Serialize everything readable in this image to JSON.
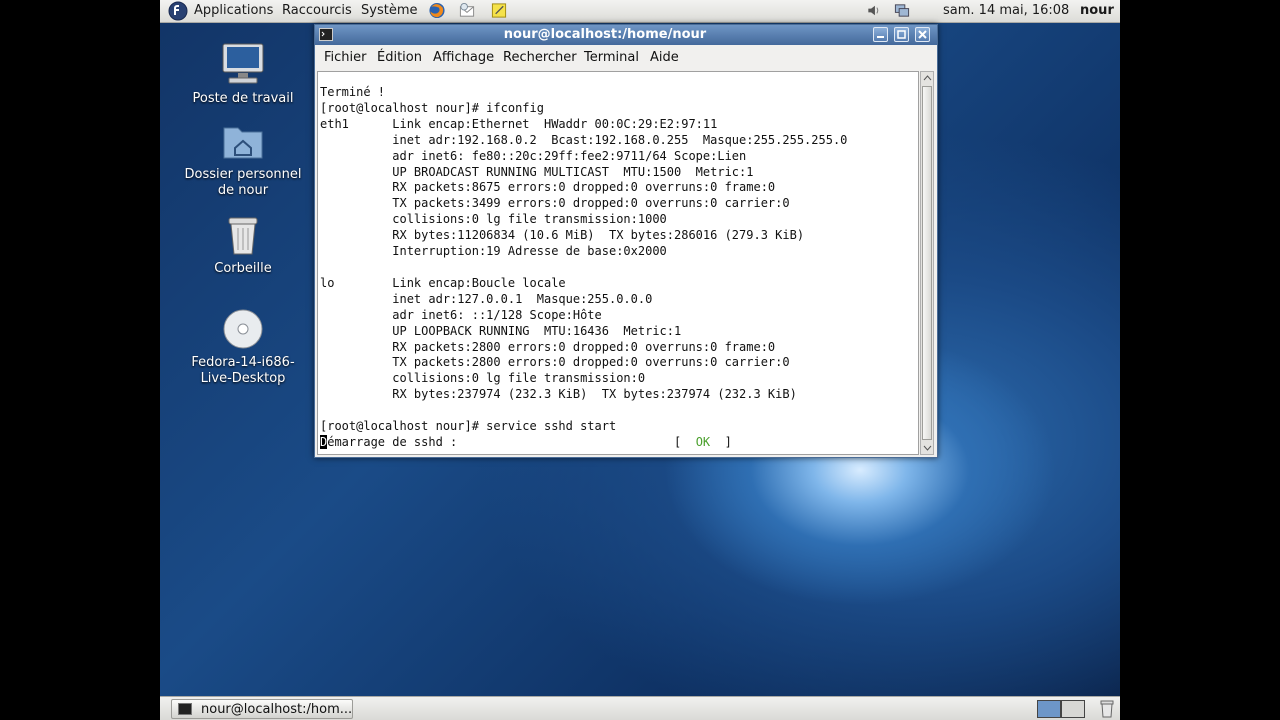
{
  "top_panel": {
    "menus": [
      "Applications",
      "Raccourcis",
      "Système"
    ],
    "clock": "sam. 14 mai, 16:08",
    "user": "nour"
  },
  "desktop_icons": [
    {
      "label": "Poste de travail",
      "icon": "computer-icon"
    },
    {
      "label": "Dossier personnel de nour",
      "icon": "home-folder-icon"
    },
    {
      "label": "Corbeille",
      "icon": "trash-icon"
    },
    {
      "label": "Fedora-14-i686-Live-Desktop",
      "icon": "dvd-icon"
    }
  ],
  "terminal": {
    "title": "nour@localhost:/home/nour",
    "menu": [
      "Fichier",
      "Édition",
      "Affichage",
      "Rechercher",
      "Terminal",
      "Aide"
    ],
    "lines": [
      "Terminé !",
      "[root@localhost nour]# ifconfig",
      "eth1      Link encap:Ethernet  HWaddr 00:0C:29:E2:97:11",
      "          inet adr:192.168.0.2  Bcast:192.168.0.255  Masque:255.255.255.0",
      "          adr inet6: fe80::20c:29ff:fee2:9711/64 Scope:Lien",
      "          UP BROADCAST RUNNING MULTICAST  MTU:1500  Metric:1",
      "          RX packets:8675 errors:0 dropped:0 overruns:0 frame:0",
      "          TX packets:3499 errors:0 dropped:0 overruns:0 carrier:0",
      "          collisions:0 lg file transmission:1000",
      "          RX bytes:11206834 (10.6 MiB)  TX bytes:286016 (279.3 KiB)",
      "          Interruption:19 Adresse de base:0x2000",
      "",
      "lo        Link encap:Boucle locale",
      "          inet adr:127.0.0.1  Masque:255.0.0.0",
      "          adr inet6: ::1/128 Scope:Hôte",
      "          UP LOOPBACK RUNNING  MTU:16436  Metric:1",
      "          RX packets:2800 errors:0 dropped:0 overruns:0 frame:0",
      "          TX packets:2800 errors:0 dropped:0 overruns:0 carrier:0",
      "          collisions:0 lg file transmission:0",
      "          RX bytes:237974 (232.3 KiB)  TX bytes:237974 (232.3 KiB)",
      "",
      "[root@localhost nour]# service sshd start"
    ],
    "last_line": {
      "cursor_char": "D",
      "text": "émarrage de sshd :                              [  ",
      "status": "OK",
      "tail": "  ]"
    },
    "colors": {
      "ok": "#4aa02c",
      "title_bar": "#5a80b3"
    }
  },
  "taskbar": {
    "window_button": "nour@localhost:/hom..."
  }
}
